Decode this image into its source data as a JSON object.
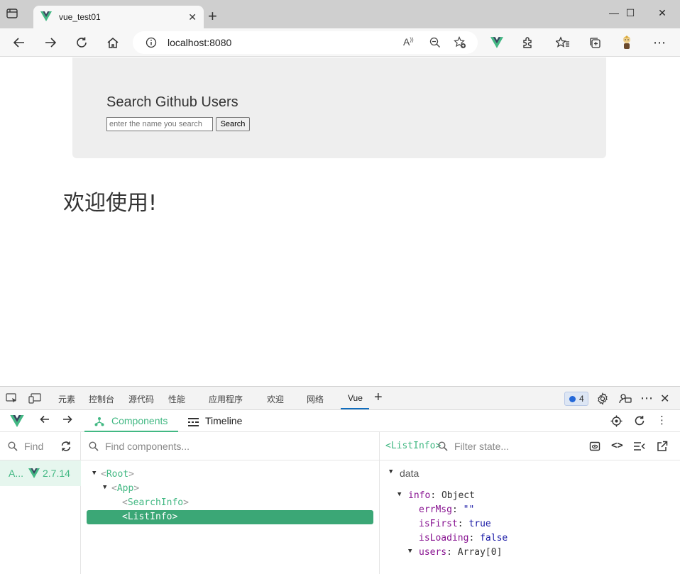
{
  "browser": {
    "tab_title": "vue_test01",
    "url": "localhost:8080",
    "window_controls": {
      "minimize": "—",
      "maximize": "☐",
      "close": "✕"
    }
  },
  "page": {
    "heading": "Search Github Users",
    "search_placeholder": "enter the name you search",
    "search_button": "Search",
    "welcome_text": "欢迎使用!"
  },
  "devtools": {
    "tabs": [
      "元素",
      "控制台",
      "源代码",
      "性能",
      "应用程序",
      "欢迎",
      "网络",
      "Vue"
    ],
    "active_tab": "Vue",
    "issues_count": "4",
    "vue": {
      "tabs": {
        "components": "Components",
        "timeline": "Timeline"
      },
      "app_search_placeholder": "Find",
      "app_name": "A...",
      "app_version": "2.7.14",
      "component_search_placeholder": "Find components...",
      "tree": [
        {
          "name": "Root"
        },
        {
          "name": "App"
        },
        {
          "name": "SearchInfo"
        },
        {
          "name": "ListInfo"
        }
      ],
      "selected_component": "<ListInfo>",
      "state_filter_placeholder": "Filter state...",
      "state": {
        "section": "data",
        "info_key": "info",
        "info_type": "Object",
        "errMsg_key": "errMsg",
        "errMsg_val": "\"\"",
        "isFirst_key": "isFirst",
        "isFirst_val": "true",
        "isLoading_key": "isLoading",
        "isLoading_val": "false",
        "users_key": "users",
        "users_val": "Array[0]"
      }
    }
  },
  "colors": {
    "vue_green": "#42b883",
    "selected_row": "#3ba776",
    "edge_blue": "#0f6cbd"
  }
}
